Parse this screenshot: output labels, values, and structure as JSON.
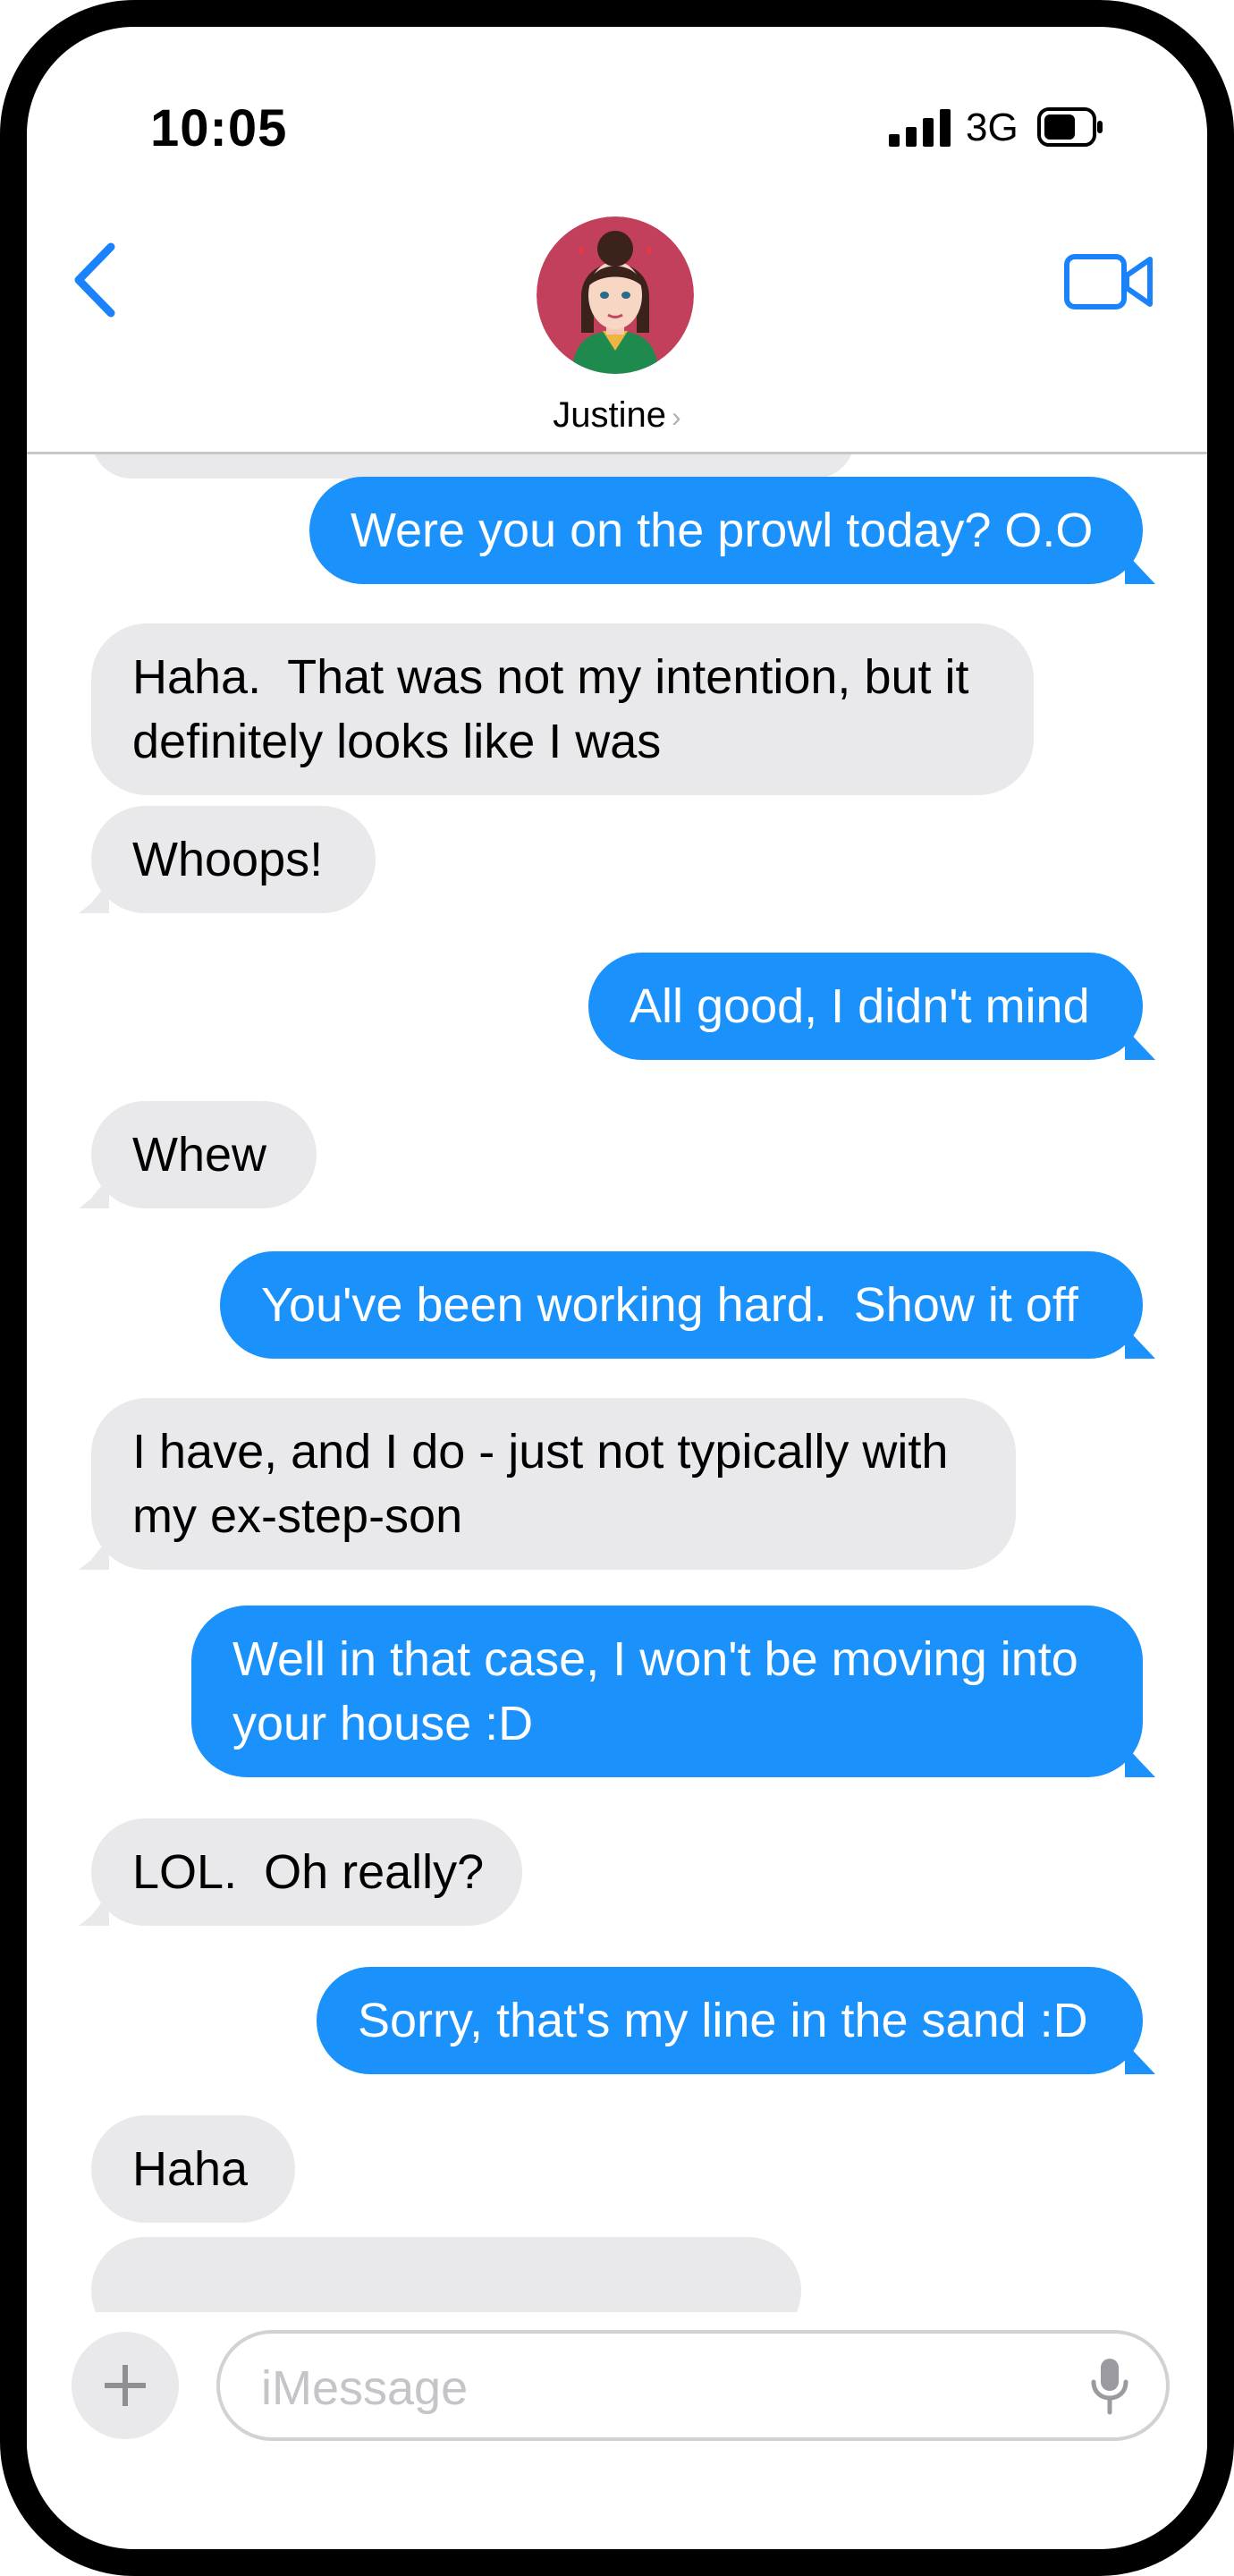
{
  "status": {
    "time": "10:05",
    "network": "3G"
  },
  "header": {
    "contact_name": "Justine",
    "chevron": "›",
    "back_icon": "chevron-left-icon",
    "video_icon": "video-camera-icon"
  },
  "colors": {
    "outgoing": "#1a91fb",
    "incoming": "#e9e9eb",
    "accent": "#1a82fb"
  },
  "messages": [
    {
      "from": "them",
      "text": ""
    },
    {
      "from": "me",
      "text": "Were you on the prowl today? O.O"
    },
    {
      "from": "them",
      "text": "Haha.  That was not my intention, but it\ndefinitely looks like I was"
    },
    {
      "from": "them",
      "text": "Whoops!"
    },
    {
      "from": "me",
      "text": "All good, I didn't mind"
    },
    {
      "from": "them",
      "text": "Whew"
    },
    {
      "from": "me",
      "text": "You've been working hard.  Show it off"
    },
    {
      "from": "them",
      "text": "I have, and I do - just not typically with\nmy ex-step-son"
    },
    {
      "from": "me",
      "text": "Well in that case, I won't be moving into\nyour house :D"
    },
    {
      "from": "them",
      "text": "LOL.  Oh really?"
    },
    {
      "from": "me",
      "text": "Sorry, that's my line in the sand :D"
    },
    {
      "from": "them",
      "text": "Haha"
    },
    {
      "from": "them",
      "text": ""
    }
  ],
  "composer": {
    "placeholder": "iMessage",
    "add_icon": "plus-icon",
    "mic_icon": "microphone-icon"
  }
}
